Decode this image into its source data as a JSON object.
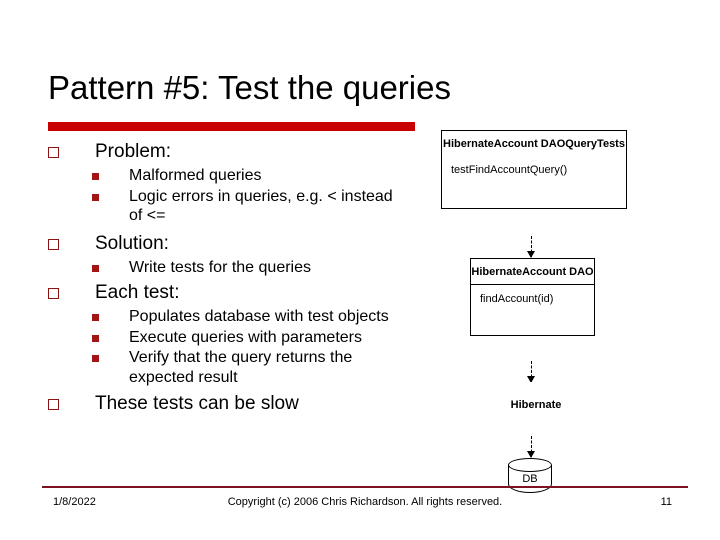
{
  "slide": {
    "title": "Pattern #5: Test the queries",
    "accent_color": "#c80000",
    "bullet_outline_color": "#8d1414",
    "bullet_fill_color": "#a31515",
    "footer_rule_color": "#7b1420"
  },
  "body": {
    "groups": [
      {
        "heading": "Problem:",
        "items": [
          "Malformed queries",
          "Logic errors in queries, e.g. < instead of <="
        ]
      },
      {
        "heading": "Solution:",
        "items": [
          "Write tests for the queries"
        ]
      },
      {
        "heading": "Each test:",
        "items": [
          "Populates database with test objects",
          "Execute queries with parameters",
          "Verify that the query returns the expected result"
        ]
      },
      {
        "heading": "These tests can be slow",
        "items": []
      }
    ]
  },
  "diagram": {
    "boxes": [
      {
        "title": "HibernateAccount DAOQueryTests",
        "method": "testFindAccountQuery()",
        "has_divider": false
      },
      {
        "title": "HibernateAccount DAO",
        "method": "findAccount(id)",
        "has_divider": true
      },
      {
        "title": "Hibernate",
        "method": "",
        "has_divider": false
      }
    ],
    "datastore_label": "DB",
    "arrow_icon": "dashed-down-arrow-icon"
  },
  "footer": {
    "date": "1/8/2022",
    "copyright": "Copyright (c)  2006 Chris Richardson. All rights reserved.",
    "page_number": "11"
  }
}
